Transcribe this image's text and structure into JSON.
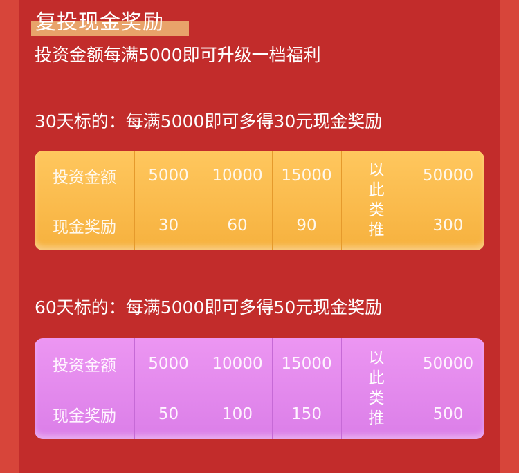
{
  "page": {
    "title": "复投现金奖励",
    "subtitle": "投资金额每满5000即可升级一档福利"
  },
  "sections": [
    {
      "label": "30天标的：每满5000即可多得30元现金奖励",
      "row_headers": [
        "投资金额",
        "现金奖励"
      ],
      "investment": [
        "5000",
        "10000",
        "15000"
      ],
      "reward": [
        "30",
        "60",
        "90"
      ],
      "etc": [
        "以",
        "此",
        "类",
        "推"
      ],
      "last_investment": "50000",
      "last_reward": "300"
    },
    {
      "label": "60天标的：每满5000即可多得50元现金奖励",
      "row_headers": [
        "投资金额",
        "现金奖励"
      ],
      "investment": [
        "5000",
        "10000",
        "15000"
      ],
      "reward": [
        "50",
        "100",
        "150"
      ],
      "etc": [
        "以",
        "此",
        "类",
        "推"
      ],
      "last_investment": "50000",
      "last_reward": "500"
    }
  ],
  "colors": {
    "background": "#d7453a",
    "panel": "#c22c2b",
    "title_highlight": "#e8a36a",
    "gold_table": "#f6b13e",
    "pink_table": "#db7ee8"
  }
}
